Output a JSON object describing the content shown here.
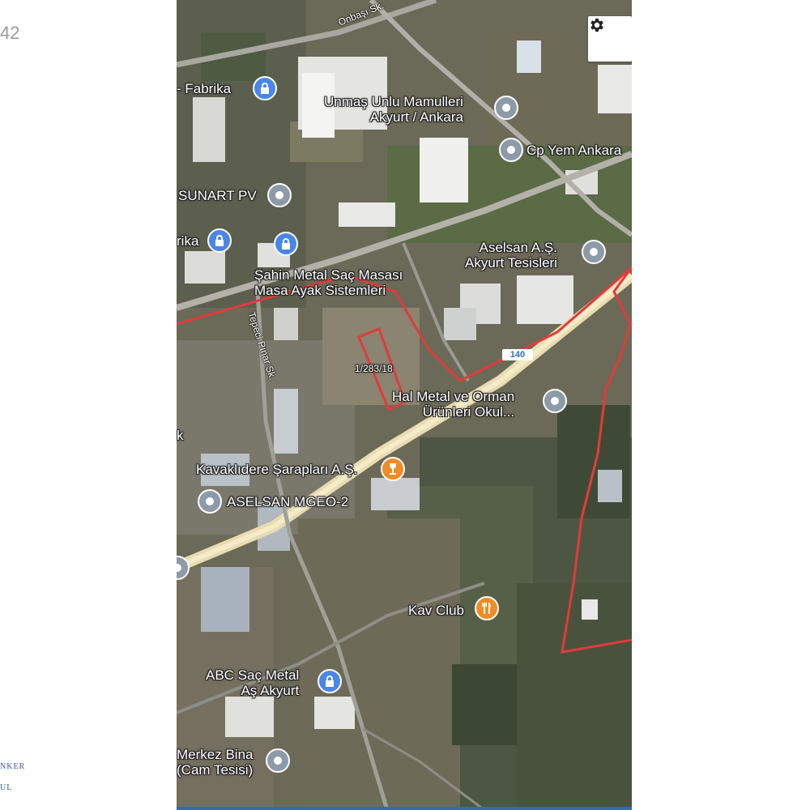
{
  "side": {
    "time_fragment": "42",
    "brand_line1": "NKER",
    "brand_line2": "UL"
  },
  "map": {
    "type": "satellite",
    "road_labels": {
      "top_street": "Onbaşı Sk.",
      "side_street": "Tepeci Pınar Sk.",
      "route": "140"
    },
    "parcel_label": "1/283/18",
    "pois": [
      {
        "id": "fabrika-top",
        "label": "- Fabrika",
        "icon": "lock-icon",
        "color": "#4a86e8"
      },
      {
        "id": "unmas",
        "label": "Unmaş Unlu Mamulleri\nAkyurt / Ankara",
        "icon": "circle-icon",
        "color": "#8d9aa8"
      },
      {
        "id": "cp-yem",
        "label": "Cp Yem Ankara",
        "icon": "circle-icon",
        "color": "#8d9aa8"
      },
      {
        "id": "sunart",
        "label": "SUNART PV",
        "icon": "circle-icon",
        "color": "#8d9aa8"
      },
      {
        "id": "fabrika-left",
        "label": "rika",
        "icon": "lock-icon",
        "color": "#4a86e8"
      },
      {
        "id": "sahin",
        "label": "",
        "icon": "lock-icon",
        "color": "#4a86e8"
      },
      {
        "id": "sahin-text",
        "label": "Şahin Metal Saç Masası\nMasa Ayak Sistemleri",
        "icon": "",
        "color": ""
      },
      {
        "id": "aselsan-akyurt",
        "label": "Aselsan A.Ş.\nAkyurt Tesisleri",
        "icon": "circle-icon",
        "color": "#8d9aa8"
      },
      {
        "id": "hal-metal",
        "label": "Hal Metal ve Orman\nÜrünleri Okul...",
        "icon": "circle-icon",
        "color": "#8d9aa8"
      },
      {
        "id": "kavaklidere",
        "label": "Kavaklıdere Şarapları A.Ş.",
        "icon": "wine-icon",
        "color": "#f08c26"
      },
      {
        "id": "aselsan-mgeo",
        "label": "ASELSAN MGEO-2",
        "icon": "circle-icon",
        "color": "#8d9aa8"
      },
      {
        "id": "kav-club",
        "label": "Kav Club",
        "icon": "restaurant-icon",
        "color": "#f08c26"
      },
      {
        "id": "abc-sac",
        "label": "ABC Saç Metal\nAş Akyurt",
        "icon": "lock-icon",
        "color": "#4a86e8"
      },
      {
        "id": "merkez-bina",
        "label": "Merkez Bina\n(Cam Tesisi)",
        "icon": "circle-icon",
        "color": "#8d9aa8"
      },
      {
        "id": "k-left",
        "label": "k",
        "icon": "",
        "color": ""
      }
    ],
    "boundary_color": "#e23b3b",
    "settings_icon": "gear-icon"
  }
}
